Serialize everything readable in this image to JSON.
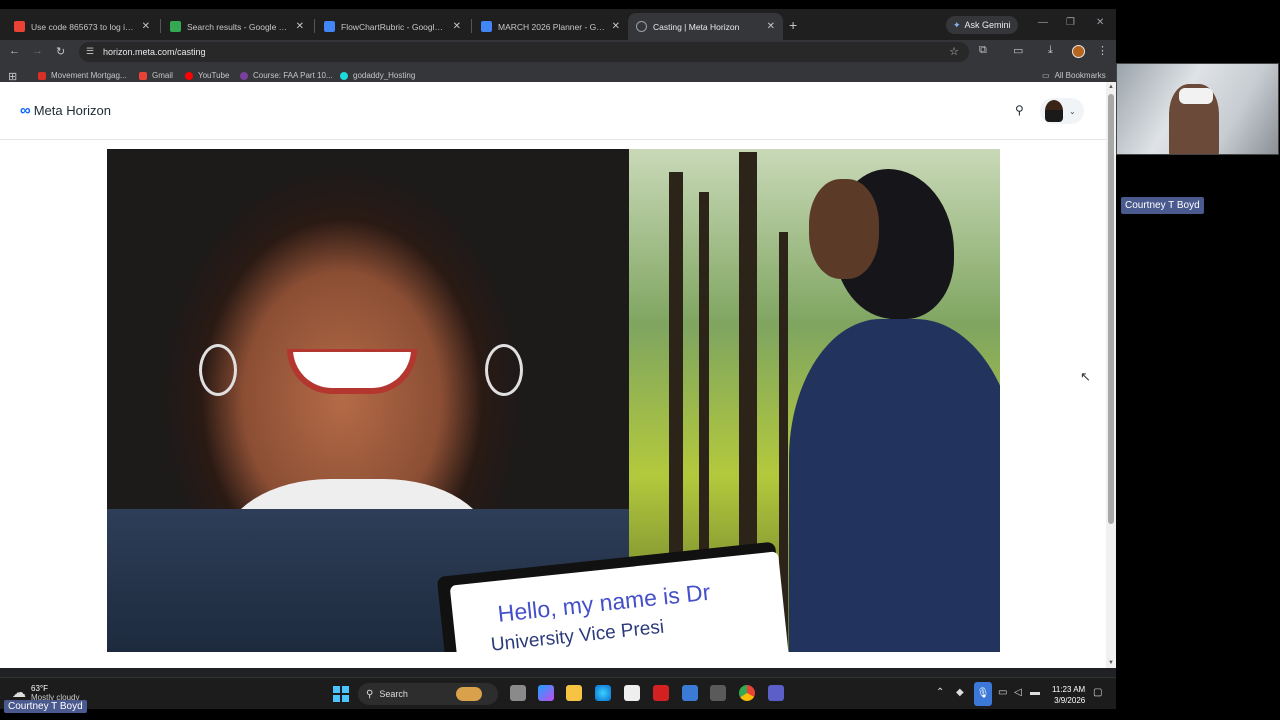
{
  "browser": {
    "tabs": [
      {
        "title": "Use code 865673 to log in - c",
        "favicon_color": "#ea4335",
        "active": false
      },
      {
        "title": "Search results - Google Drive",
        "favicon_color": "#34a853",
        "active": false
      },
      {
        "title": "FlowChartRubric - Google Docs",
        "favicon_color": "#4285f4",
        "active": false
      },
      {
        "title": "MARCH 2026 Planner - Google",
        "favicon_color": "#4285f4",
        "active": false
      },
      {
        "title": "Casting | Meta Horizon",
        "favicon_color": "#9aa0a6",
        "active": true
      }
    ],
    "new_tab": "+",
    "gemini_label": "Ask Gemini",
    "url": "horizon.meta.com/casting",
    "bookmarks": [
      {
        "label": "Movement Mortgag...",
        "color": "#d93025"
      },
      {
        "label": "Gmail",
        "color": "#ea4335"
      },
      {
        "label": "YouTube",
        "color": "#ff0000"
      },
      {
        "label": "Course: FAA Part 10...",
        "color": "#7b3fa0"
      },
      {
        "label": "godaddy_Hosting",
        "color": "#1bdbdb"
      }
    ],
    "all_bookmarks": "All Bookmarks"
  },
  "site": {
    "logo_text": "Meta Horizon",
    "sign_line1": "Hello, my name is Dr",
    "sign_line2": "University Vice Presi"
  },
  "participant": {
    "name": "Courtney T Boyd"
  },
  "taskbar": {
    "temperature": "63°F",
    "weather_desc": "Mostly cloudy",
    "search_label": "Search",
    "time": "11:23 AM",
    "date": "3/9/2026",
    "accent": "#4cc2ff"
  },
  "colors": {
    "meta_blue": "#0866ff",
    "name_badge": "#4a5a8e"
  }
}
